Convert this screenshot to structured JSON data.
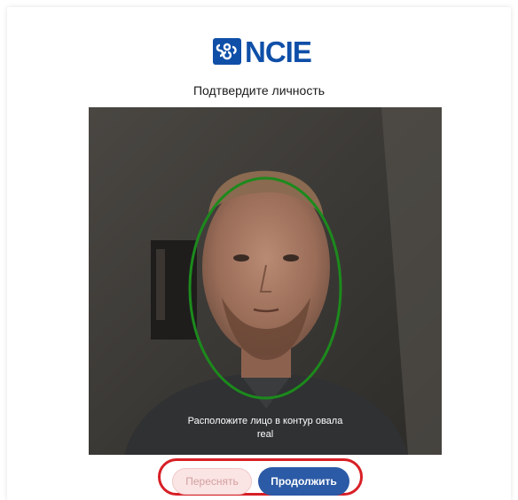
{
  "brand": {
    "logo_text": "NCIE",
    "logo_color": "#0f4fa8"
  },
  "page": {
    "subtitle": "Подтвердите личность"
  },
  "camera": {
    "hint_line1": "Расположите лицо в контур овала",
    "hint_line2": "real",
    "face_outline_color": "#1c8a1c"
  },
  "actions": {
    "retake_label": "Переснять",
    "continue_label": "Продолжить",
    "highlight_color": "#d81f26",
    "continue_color": "#2b5aa6"
  }
}
